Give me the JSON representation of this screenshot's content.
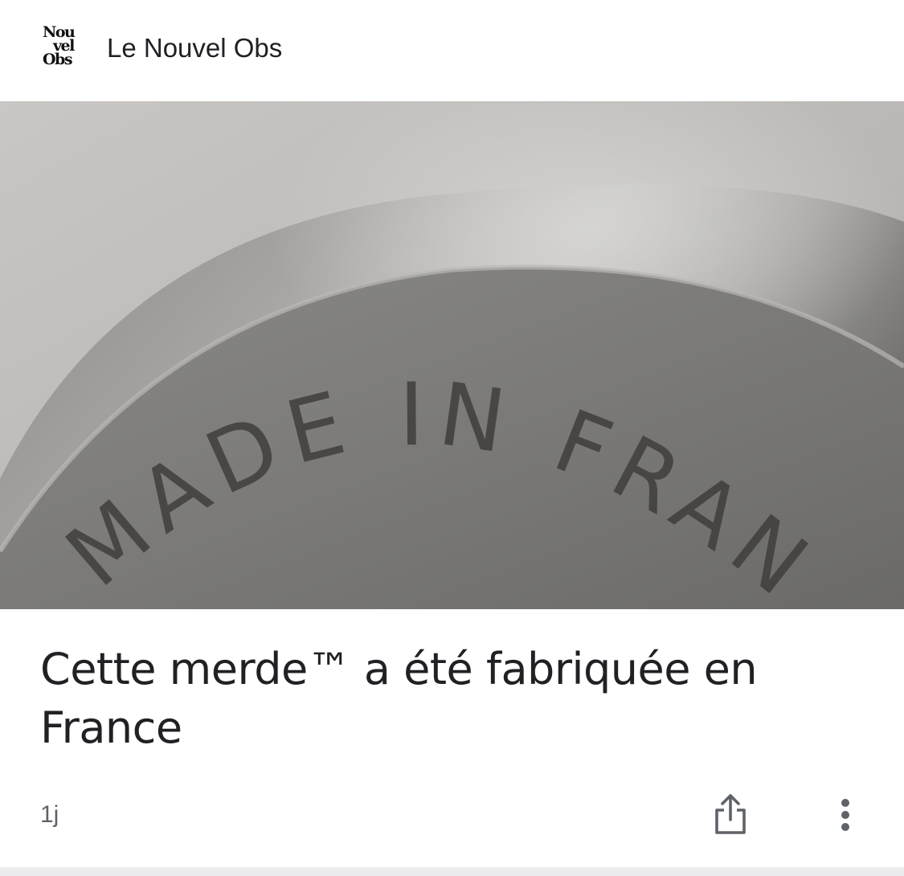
{
  "publisher": {
    "logo_text": [
      "Nou",
      "vel",
      "Obs"
    ],
    "name": "Le Nouvel Obs"
  },
  "hero_image": {
    "description_icon": "made-in-france-engraved-pan-image",
    "engraving": "MADE IN FRANCE"
  },
  "article": {
    "headline": "Cette merde™ a été fabriquée en France",
    "age": "1j"
  },
  "actions": {
    "share_icon": "share-icon",
    "more_icon": "more-vert-icon"
  },
  "colors": {
    "text_primary": "#202124",
    "text_secondary": "#5f6368",
    "divider": "#ececee"
  }
}
